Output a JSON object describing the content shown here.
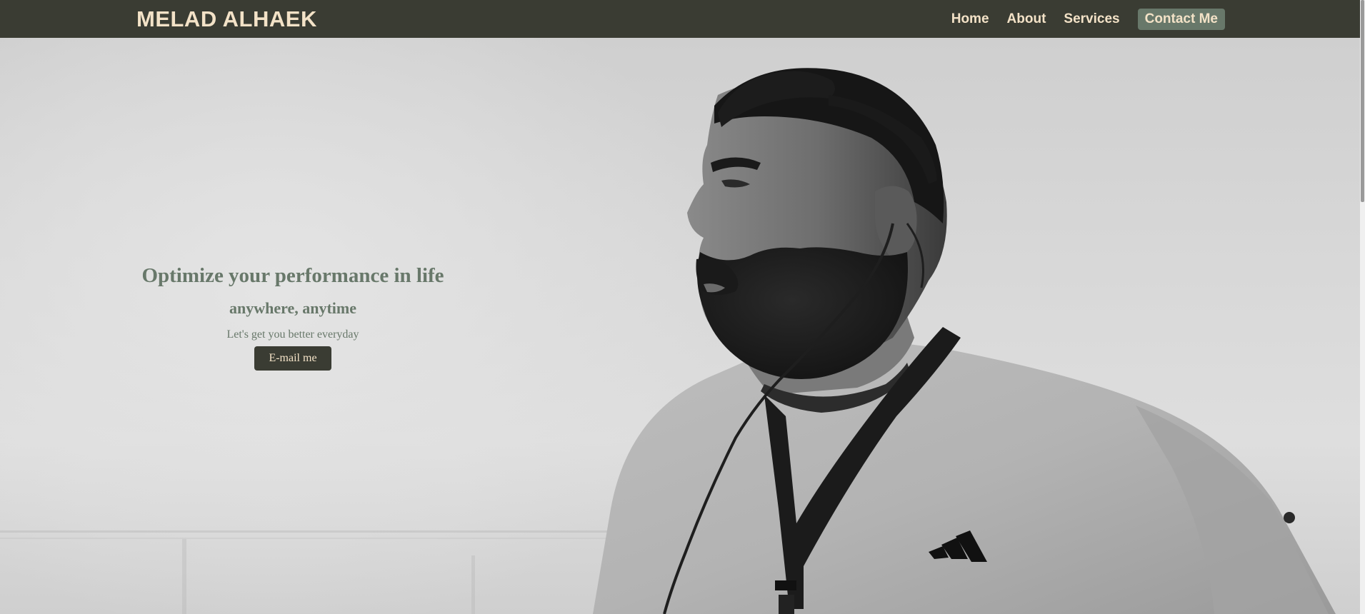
{
  "navbar": {
    "brand": "MELAD ALHAEK",
    "links": [
      {
        "label": "Home"
      },
      {
        "label": "About"
      },
      {
        "label": "Services"
      },
      {
        "label": "Contact Me"
      }
    ]
  },
  "hero": {
    "title": "Optimize your performance in life",
    "subtitle": "anywhere, anytime",
    "tagline": "Let's get you better everyday",
    "cta_label": "E-mail me",
    "image": "black-and-white photo of a bearded man wearing sunglasses on his head, a t-shirt with a three-stripe logo, a lanyard and an earpiece"
  },
  "colors": {
    "navbar_bg": "#3a3c33",
    "brand_text": "#f3e2c7",
    "accent_green": "#68786a",
    "button_bg": "#3a3c33"
  }
}
